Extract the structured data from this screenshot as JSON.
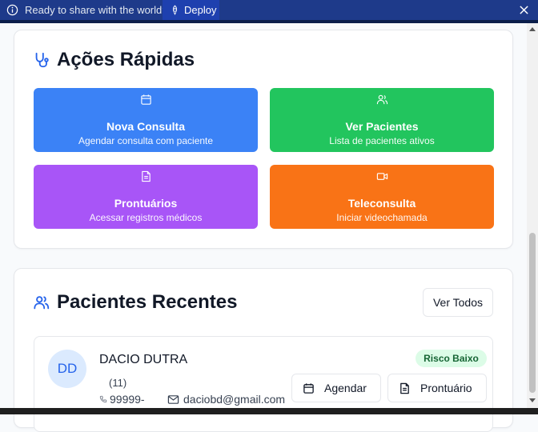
{
  "banner": {
    "message": "Ready to share with the world?",
    "deploy_label": "Deploy"
  },
  "quick_actions": {
    "title": "Ações Rápidas",
    "tiles": [
      {
        "label": "Nova Consulta",
        "subtitle": "Agendar consulta com paciente",
        "color": "#3b82f6",
        "icon": "calendar-icon"
      },
      {
        "label": "Ver Pacientes",
        "subtitle": "Lista de pacientes ativos",
        "color": "#22c55e",
        "icon": "users-icon"
      },
      {
        "label": "Prontuários",
        "subtitle": "Acessar registros médicos",
        "color": "#a855f7",
        "icon": "file-text-icon"
      },
      {
        "label": "Teleconsulta",
        "subtitle": "Iniciar videochamada",
        "color": "#f97316",
        "icon": "video-icon"
      }
    ]
  },
  "recent_patients": {
    "title": "Pacientes Recentes",
    "view_all_label": "Ver Todos",
    "patients": [
      {
        "initials": "DD",
        "name": "DACIO DUTRA",
        "risk": "Risco Baixo",
        "phone_line1": "(11)",
        "phone_line2": "99999-",
        "email": "daciobd@gmail.com",
        "schedule_label": "Agendar",
        "record_label": "Prontuário"
      }
    ]
  }
}
